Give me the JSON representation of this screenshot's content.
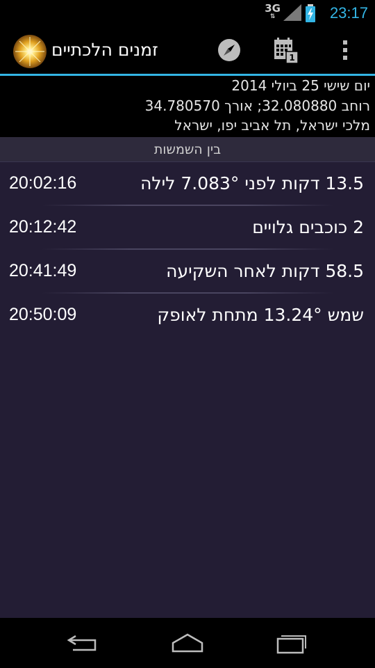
{
  "status_bar": {
    "network_type": "3G",
    "time": "23:17"
  },
  "action_bar": {
    "title": "זמנים הלכתיים",
    "icons": [
      "app-sun-icon",
      "compass-icon",
      "calendar-icon",
      "overflow-menu-icon"
    ]
  },
  "info": {
    "date": "יום שישי 25 ביולי 2014",
    "coordinates": "רוחב 32.080880; אורך 34.780570",
    "location": "מלכי ישראל, תל אביב יפו, ישראל"
  },
  "section": {
    "header": "בין השמשות"
  },
  "rows": [
    {
      "label": "13.5 דקות לפני 7.083° לילה",
      "time": "20:02:16"
    },
    {
      "label": "2 כוכבים גלויים",
      "time": "20:12:42"
    },
    {
      "label": "58.5 דקות לאחר השקיעה",
      "time": "20:41:49"
    },
    {
      "label": "שמש 13.24° מתחת לאופק",
      "time": "20:50:09"
    }
  ],
  "colors": {
    "accent": "#33b5e5",
    "list_background": "#231d34",
    "section_header_background": "#2e2a3c"
  }
}
